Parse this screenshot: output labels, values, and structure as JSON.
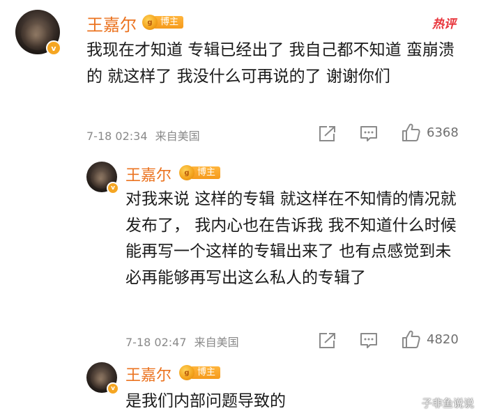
{
  "hot_label": "热评",
  "watermark": "子非鱼说说",
  "comments": [
    {
      "username": "王嘉尔",
      "badge_label": "博主",
      "text": "我现在才知道 专辑已经出了 我自己都不知道 蛮崩溃的 就这样了 我没什么可再说的了 谢谢你们",
      "time": "7-18 02:34",
      "location": "来自美国",
      "likes": "6368"
    },
    {
      "username": "王嘉尔",
      "badge_label": "博主",
      "text": "对我来说 这样的专辑 就这样在不知情的情况就发布了， 我内心也在告诉我 我不知道什么时候能再写一个这样的专辑出来了 也有点感觉到未必再能够再写出这么私人的专辑了",
      "time": "7-18 02:47",
      "location": "来自美国",
      "likes": "4820"
    },
    {
      "username": "王嘉尔",
      "badge_label": "博主",
      "text": "是我们内部问题导致的"
    }
  ],
  "colors": {
    "username": "#eb7320",
    "badge": "#f59a1b",
    "hot": "#e8333a",
    "meta": "#8a8a8a"
  },
  "icons": [
    "verified-badge-icon",
    "share-icon",
    "comment-icon",
    "like-icon"
  ]
}
